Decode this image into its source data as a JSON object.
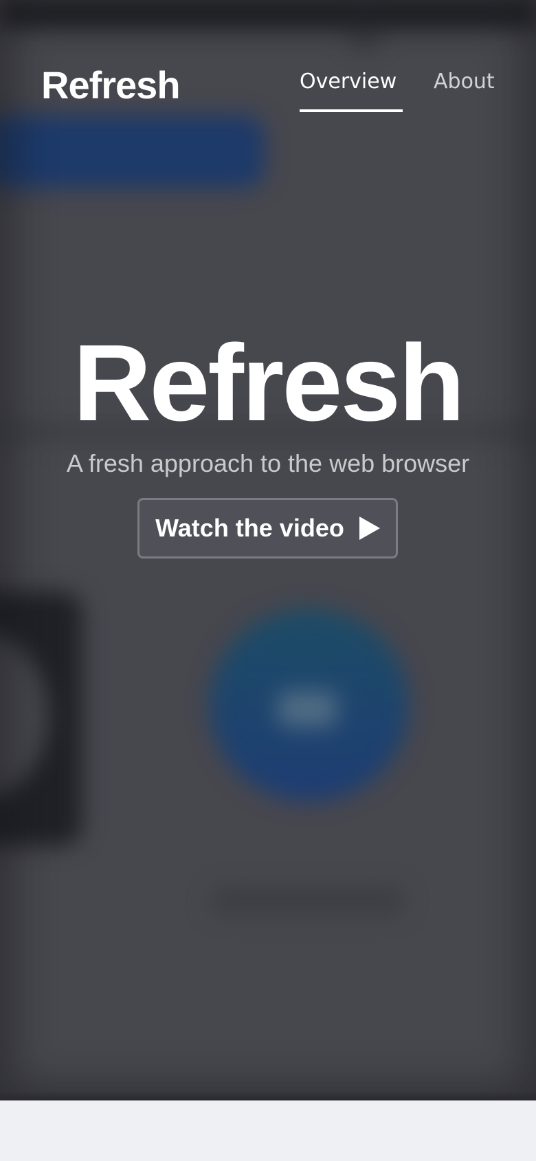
{
  "header": {
    "brand": "Refresh",
    "nav": [
      {
        "label": "Overview",
        "active": true
      },
      {
        "label": "About",
        "active": false
      }
    ]
  },
  "hero": {
    "title": "Refresh",
    "subtitle": "A fresh approach to the web browser",
    "cta_label": "Watch the video",
    "cta_icon": "play-icon"
  },
  "colors": {
    "hero_background": "#47474e",
    "page_background": "#eff0f4",
    "text_primary": "#ffffff",
    "text_secondary": "#c9c9ce",
    "button_background": "#505058",
    "button_border": "#7b7b82"
  }
}
